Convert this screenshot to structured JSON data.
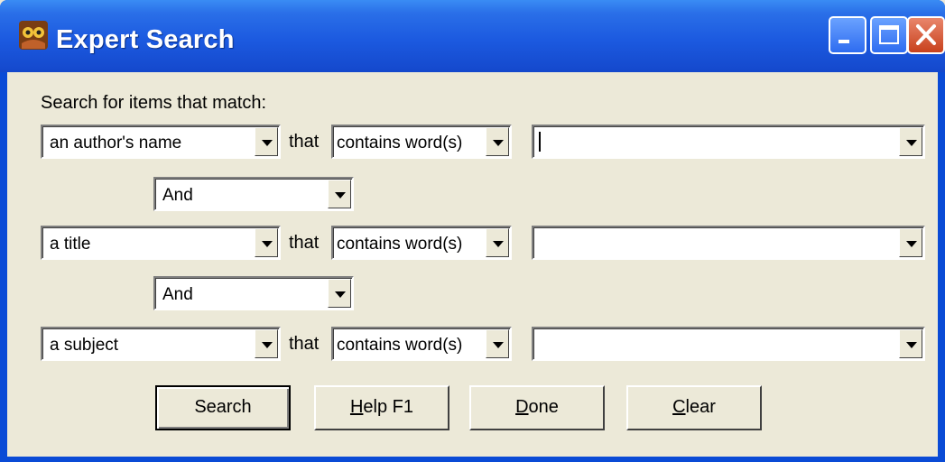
{
  "window": {
    "title": "Expert Search",
    "app_icon": "owl-icon"
  },
  "titlebar_buttons": {
    "minimize": "minimize-icon",
    "maximize": "maximize-icon",
    "close": "close-icon"
  },
  "form": {
    "prompt": "Search for items that match:",
    "that_label": "that",
    "rows": [
      {
        "field": "an author's name",
        "operator": "contains word(s)",
        "term": ""
      },
      {
        "field": "a title",
        "operator": "contains word(s)",
        "term": ""
      },
      {
        "field": "a subject",
        "operator": "contains word(s)",
        "term": ""
      }
    ],
    "connectors": [
      "And",
      "And"
    ]
  },
  "buttons": {
    "search": "Search",
    "help": "Help F1",
    "done": "Done",
    "clear": "Clear"
  },
  "colors": {
    "titlebar": "#1c5ae0",
    "face": "#ece9d8",
    "close": "#c8411c"
  }
}
